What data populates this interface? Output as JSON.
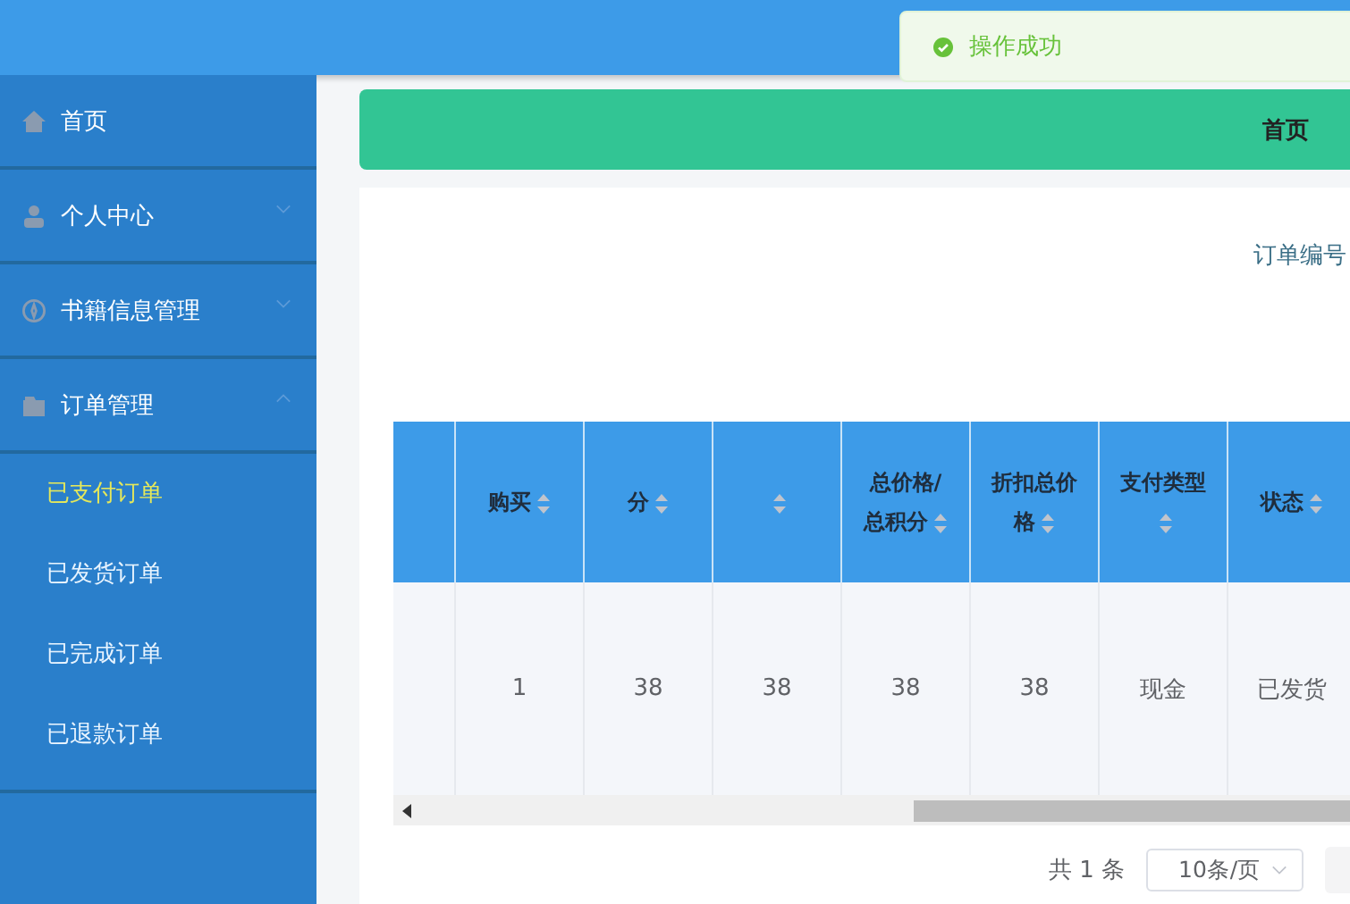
{
  "toast": {
    "kind": "success",
    "message": "操作成功"
  },
  "sidebar": {
    "items": [
      {
        "label": "首页",
        "has_children": false
      },
      {
        "label": "个人中心",
        "expanded": false,
        "has_children": true
      },
      {
        "label": "书籍信息管理",
        "expanded": false,
        "has_children": true
      },
      {
        "label": "订单管理",
        "expanded": true,
        "has_children": true,
        "children": [
          {
            "label": "已支付订单",
            "selected": true
          },
          {
            "label": "已发货订单",
            "selected": false
          },
          {
            "label": "已完成订单",
            "selected": false
          },
          {
            "label": "已退款订单",
            "selected": false
          }
        ]
      }
    ]
  },
  "breadcrumb": {
    "label": "首页"
  },
  "search": {
    "label": "订单编号"
  },
  "table": {
    "columns": [
      {
        "sortable": false
      },
      {
        "label": "购买",
        "sortable": true
      },
      {
        "label": "分",
        "sortable": true
      },
      {
        "sortable": true
      },
      {
        "label": "总价格/总积分",
        "sortable": true
      },
      {
        "label": "折扣总价格",
        "sortable": true
      },
      {
        "label": "支付类型",
        "sortable": true
      },
      {
        "label": "状态",
        "sortable": true
      }
    ],
    "rows": [
      [
        "",
        "1",
        "38",
        "38",
        "38",
        "38",
        "现金",
        "已发货"
      ]
    ]
  },
  "pagination": {
    "total": "共 1 条",
    "page_size": "10条/页"
  }
}
